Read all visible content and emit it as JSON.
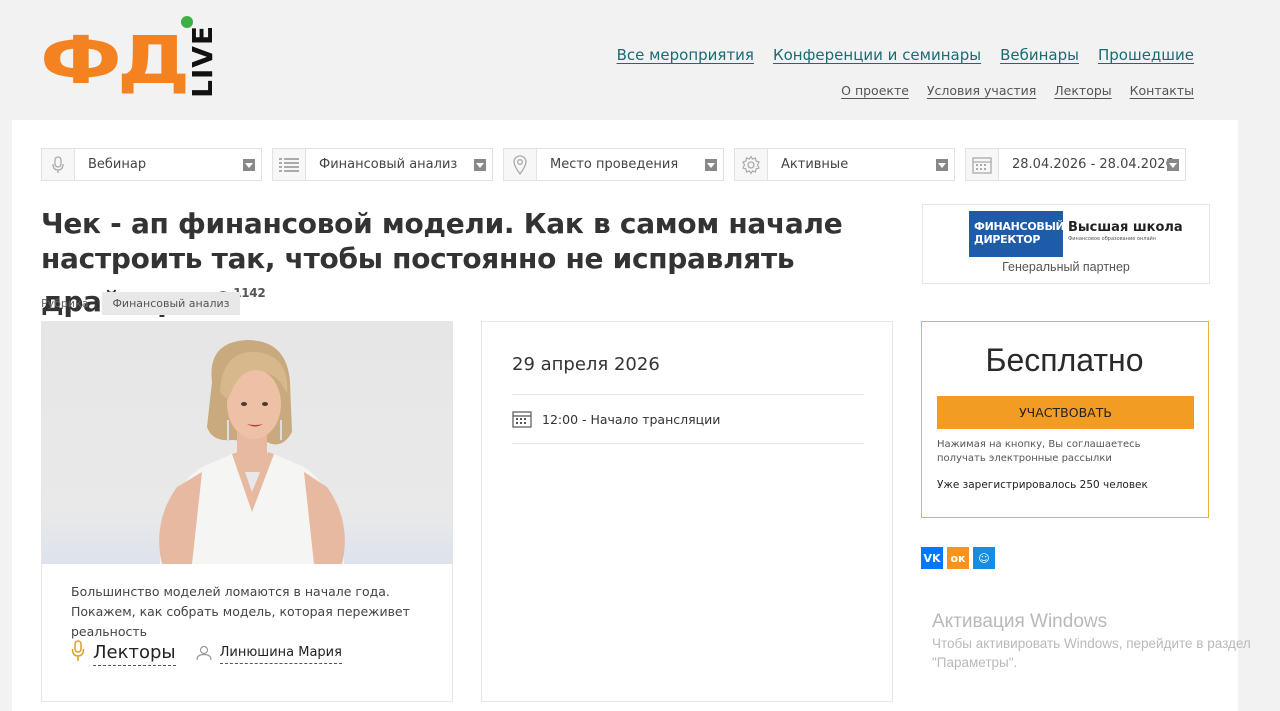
{
  "logo": {
    "main": "ФД",
    "sub": "LIVE"
  },
  "top_nav": [
    "Все мероприятия",
    "Конференции и семинары",
    "Вебинары",
    "Прошедшие"
  ],
  "sub_nav": [
    "О проекте",
    "Условия участия",
    "Лекторы",
    "Контакты"
  ],
  "filters": [
    {
      "label": "Вебинар",
      "icon": "microphone-icon"
    },
    {
      "label": "Финансовый анализ",
      "icon": "list-icon"
    },
    {
      "label": "Место проведения",
      "icon": "map-pin-icon"
    },
    {
      "label": "Активные",
      "icon": "gear-icon"
    },
    {
      "label": "28.04.2026 - 28.04.2026",
      "icon": "calendar-icon"
    }
  ],
  "event": {
    "title": "Чек - ап финансовой модели. Как в самом начале настроить так, чтобы постоянно не исправлять драйверы",
    "views": "1142",
    "rubric_label": "Рубрика",
    "rubric_tag": "Финансовый анализ",
    "description": "Большинство моделей ломаются в начале года. Покажем, как собрать модель, которая переживет реальность",
    "lectors_label": "Лекторы",
    "lector_name": "Линюшина Мария",
    "date": "29 апреля 2026",
    "time": "12:00 - Начало трансляции"
  },
  "partner": {
    "logo_blue": "ФИНАНСОВЫЙ ДИРЕКТОР",
    "logo_title": "Высшая школа",
    "logo_sub": "Финансовое образование онлайн",
    "caption": "Генеральный партнер"
  },
  "registration": {
    "price": "Бесплатно",
    "button": "УЧАСТВОВАТЬ",
    "note": "Нажимая на кнопку, Вы соглашаетесь получать электронные рассылки",
    "registered": "Уже зарегистрировалось 250 человек"
  },
  "social": [
    {
      "name": "vk",
      "glyph": "VK",
      "color": "#0077ff"
    },
    {
      "name": "ok",
      "glyph": "ок",
      "color": "#f7931e"
    },
    {
      "name": "mm",
      "glyph": "☺",
      "color": "#168de2"
    }
  ],
  "watermark": {
    "title": "Активация Windows",
    "text": "Чтобы активировать Windows, перейдите в раздел \"Параметры\"."
  },
  "colors": {
    "accent": "#f58220",
    "link": "#1c6a75",
    "button": "#f39c23",
    "border_highlight": "#e8b33a"
  }
}
